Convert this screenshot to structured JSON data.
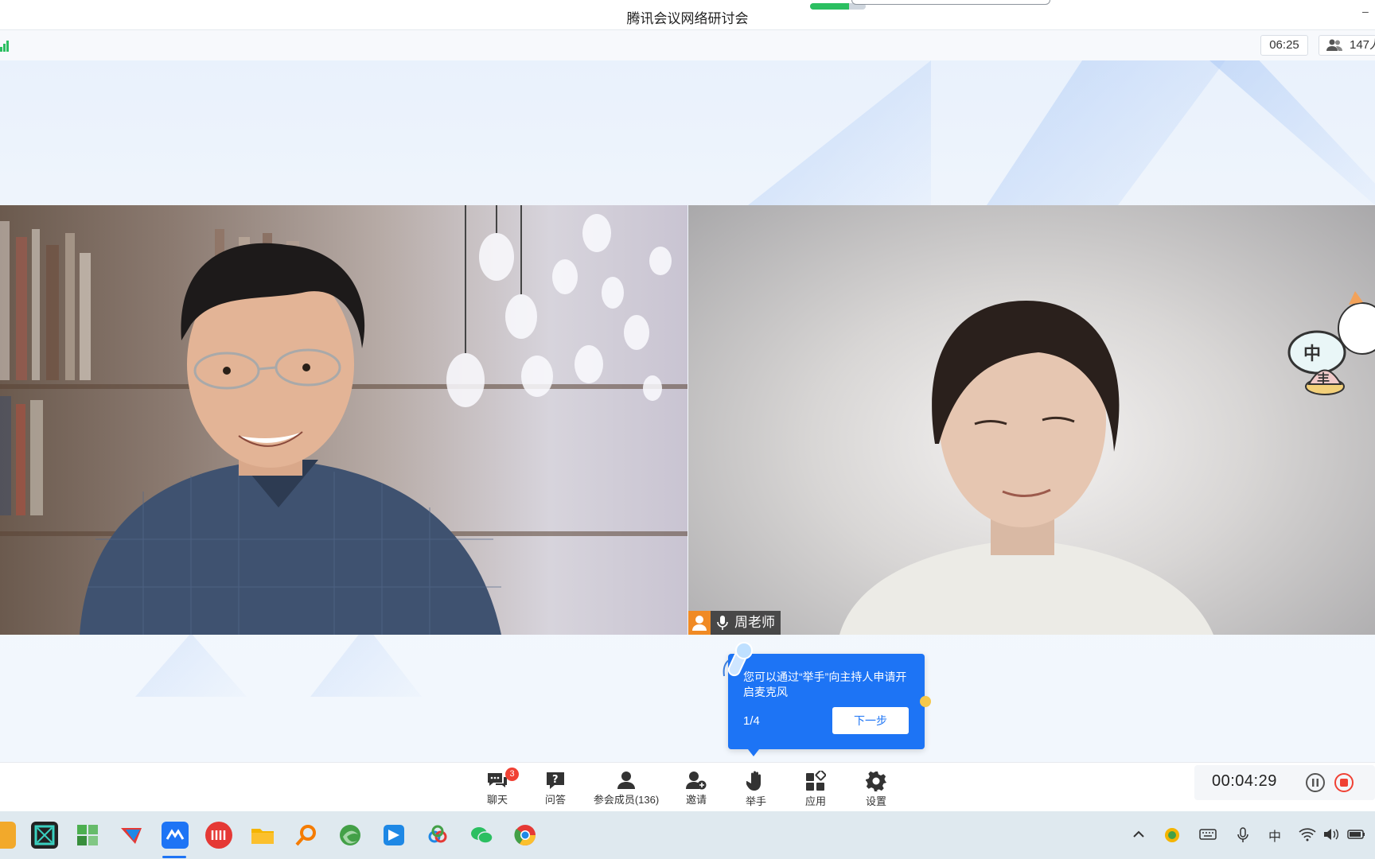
{
  "window": {
    "title": "腾讯会议网络研讨会"
  },
  "title_progress_fraction": 0.7,
  "infobar": {
    "meeting_clock": "06:25",
    "participant_count_text": "147人"
  },
  "participants_on_stage": [
    {
      "name": "",
      "role": "speaker-left"
    },
    {
      "name": "周老师",
      "role": "speaker-right"
    }
  ],
  "guide_popup": {
    "text": "您可以通过“举手”向主持人申请开启麦克风",
    "step": "1/4",
    "next_label": "下一步"
  },
  "toolbar": {
    "items": [
      {
        "label": "聊天",
        "icon": "chat-icon",
        "badge": "3"
      },
      {
        "label": "问答",
        "icon": "question-icon"
      },
      {
        "label": "参会成员(136)",
        "icon": "members-icon"
      },
      {
        "label": "邀请",
        "icon": "invite-icon"
      },
      {
        "label": "举手",
        "icon": "raise-hand-icon"
      },
      {
        "label": "应用",
        "icon": "apps-icon"
      },
      {
        "label": "设置",
        "icon": "settings-icon"
      }
    ]
  },
  "recording": {
    "elapsed": "00:04:29",
    "pause_icon": "pause-icon",
    "stop_icon": "stop-record-icon"
  },
  "taskbar": {
    "apps": [
      "folder-icon",
      "box-app-icon",
      "windows-start-icon",
      "bird-app-icon",
      "tencent-meeting-icon",
      "iqiyi-icon",
      "file-explorer-icon",
      "search-icon",
      "edge-icon",
      "feishu-icon",
      "cloud-app-icon",
      "wechat-icon",
      "chrome-icon"
    ],
    "tray": [
      "chevron-up-icon",
      "app-tray-icon",
      "keyboard-icon",
      "microphone-icon",
      "ime-icon",
      "wifi-icon",
      "speaker-icon",
      "battery-icon"
    ],
    "ime_label": "中"
  },
  "colors": {
    "accent": "#1d74f5",
    "record_red": "#f04134",
    "badge_red": "#f04134",
    "host_orange": "#f08a24"
  }
}
